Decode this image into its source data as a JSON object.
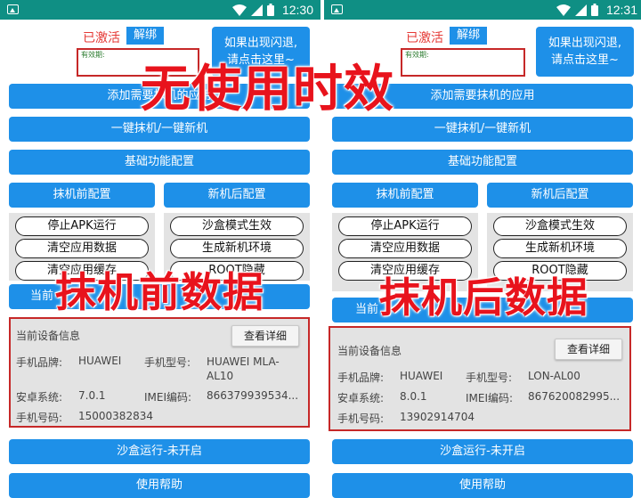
{
  "status_bar": {
    "left_time": "12:30",
    "right_time": "12:31"
  },
  "header": {
    "activated": "已激活",
    "unbind": "解绑",
    "expiry_label": "有效期:",
    "hint": "如果出现闪退,\n请点击这里~"
  },
  "buttons": {
    "add_apps": "添加需要抹机的应用",
    "one_key": "一键抹机/一键新机",
    "basic_config": "基础功能配置",
    "before_config": "抹机前配置",
    "after_config": "新机后配置",
    "sandbox": "沙盒运行-未开启",
    "help": "使用帮助",
    "current_partial": "当前"
  },
  "toggles": {
    "stop_apk": "停止APK运行",
    "sandbox_mode": "沙盒模式生效",
    "clear_data": "清空应用数据",
    "gen_env": "生成新机环境",
    "clear_cache": "清空应用缓存",
    "root_hide": "ROOT隐藏"
  },
  "device": {
    "title": "当前设备信息",
    "detail_btn": "查看详细",
    "brand_label": "手机品牌:",
    "model_label": "手机型号:",
    "android_label": "安卓系统:",
    "imei_label": "IMEI编码:",
    "phone_label": "手机号码:",
    "left": {
      "brand": "HUAWEI",
      "model": "HUAWEI MLA-AL10",
      "android": "7.0.1",
      "imei": "866379939534...",
      "phone": "15000382834"
    },
    "right": {
      "brand": "HUAWEI",
      "model": "LON-AL00",
      "android": "8.0.1",
      "imei": "867620082995...",
      "phone": "13902914704"
    }
  },
  "overlays": {
    "no_time_limit": "无使用时效",
    "before_data": "抹机前数据",
    "after_data": "抹机后数据"
  },
  "colors": {
    "accent": "#1e90e8",
    "status_bar": "#0f8f84",
    "overlay_red": "#e8131c",
    "border_red": "#c62828"
  }
}
